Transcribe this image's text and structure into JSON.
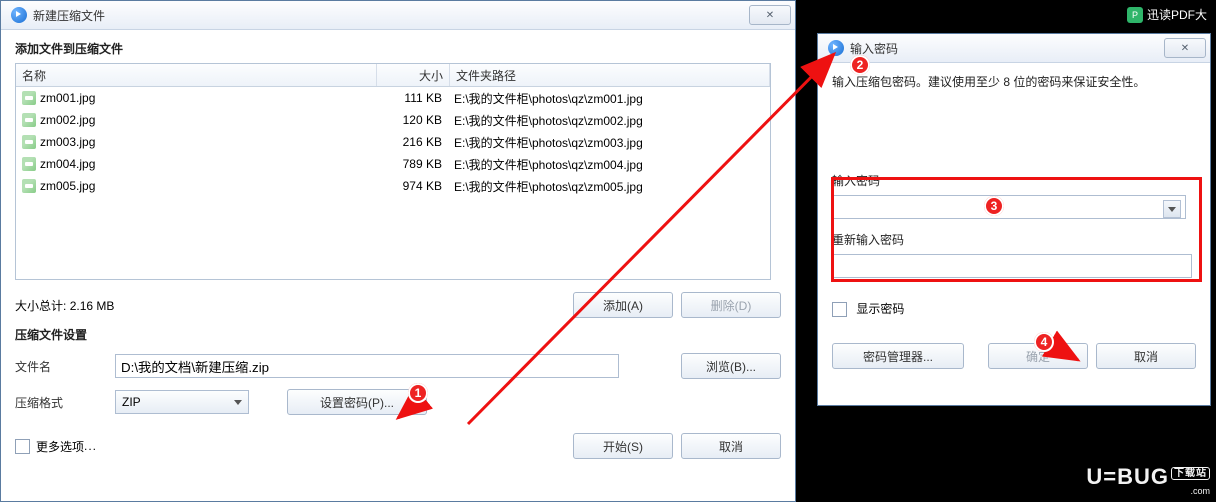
{
  "taskbar": {
    "pdf_app": "迅读PDF大"
  },
  "dialog1": {
    "title": "新建压缩文件",
    "close_glyph": "✕",
    "add_section_label": "添加文件到压缩文件",
    "columns": {
      "name": "名称",
      "size": "大小",
      "path": "文件夹路径"
    },
    "files": [
      {
        "name": "zm001.jpg",
        "size": "111 KB",
        "path": "E:\\我的文件柜\\photos\\qz\\zm001.jpg"
      },
      {
        "name": "zm002.jpg",
        "size": "120 KB",
        "path": "E:\\我的文件柜\\photos\\qz\\zm002.jpg"
      },
      {
        "name": "zm003.jpg",
        "size": "216 KB",
        "path": "E:\\我的文件柜\\photos\\qz\\zm003.jpg"
      },
      {
        "name": "zm004.jpg",
        "size": "789 KB",
        "path": "E:\\我的文件柜\\photos\\qz\\zm004.jpg"
      },
      {
        "name": "zm005.jpg",
        "size": "974 KB",
        "path": "E:\\我的文件柜\\photos\\qz\\zm005.jpg"
      }
    ],
    "totals_label": "大小总计:",
    "totals_value": "2.16 MB",
    "add_button": "添加(A)",
    "delete_button": "删除(D)",
    "settings_label": "压缩文件设置",
    "filename_label": "文件名",
    "filename_value": "D:\\我的文档\\新建压缩.zip",
    "browse_button": "浏览(B)...",
    "format_label": "压缩格式",
    "format_value": "ZIP",
    "set_password_button": "设置密码(P)...",
    "more_options_label": "更多选项",
    "more_options_ellipsis": "...",
    "start_button": "开始(S)",
    "cancel_button": "取消"
  },
  "dialog2": {
    "title": "输入密码",
    "close_glyph": "✕",
    "instruction": "输入压缩包密码。建议使用至少 8 位的密码来保证安全性。",
    "enter_pw_label": "输入密码",
    "reenter_pw_label": "重新输入密码",
    "show_pw_label": "显示密码",
    "pw_manager_button": "密码管理器...",
    "ok_button": "确定",
    "cancel_button": "取消"
  },
  "badges": {
    "b1": "1",
    "b2": "2",
    "b3": "3",
    "b4": "4"
  },
  "watermark": {
    "main": "U.BUG",
    "sub": ".com",
    "tag": "下载站"
  }
}
